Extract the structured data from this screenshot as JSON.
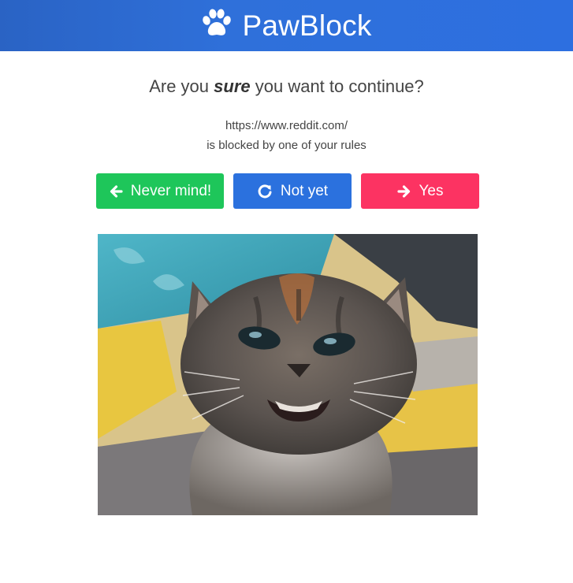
{
  "header": {
    "title": "PawBlock",
    "logo_icon": "paw-icon",
    "gradient": [
      "#2a63c4",
      "#2d6fe0"
    ]
  },
  "prompt": {
    "prefix": "Are you ",
    "emphasis": "sure",
    "suffix": " you want to continue?"
  },
  "blocked": {
    "url": "https://www.reddit.com/",
    "message": "is blocked by one of your rules"
  },
  "buttons": {
    "never_mind": {
      "label": "Never mind!",
      "icon": "arrow-left-icon",
      "color": "#1ec65a"
    },
    "not_yet": {
      "label": "Not yet",
      "icon": "redo-icon",
      "color": "#2b71de"
    },
    "yes": {
      "label": "Yes",
      "icon": "arrow-right-icon",
      "color": "#fc3362"
    }
  },
  "image": {
    "subject": "kitten"
  }
}
